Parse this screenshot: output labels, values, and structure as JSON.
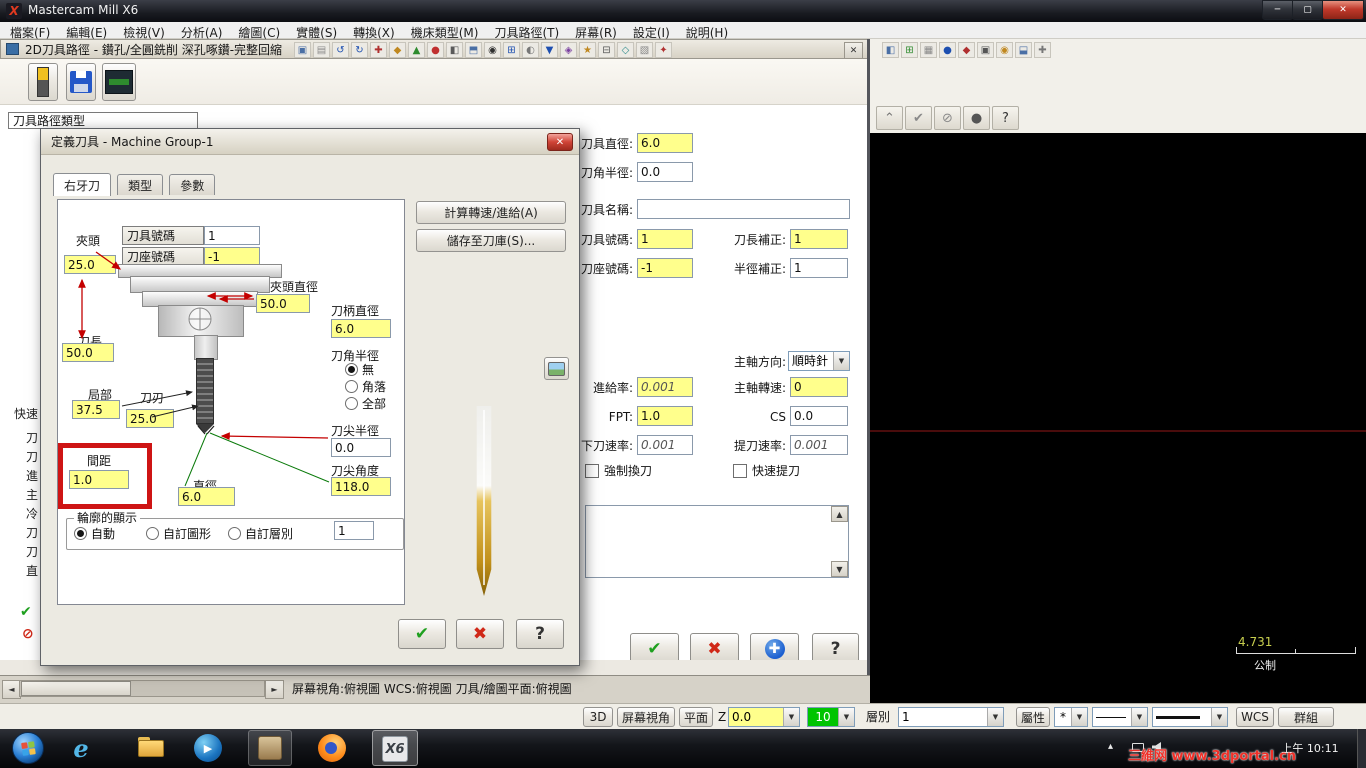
{
  "icons": {
    "close": "✕",
    "minimize": "─",
    "maximize": "▢",
    "dropdown": "▼",
    "up": "▲",
    "down": "▼",
    "left": "◄",
    "right": "►",
    "check": "✔",
    "cross": "✖",
    "help": "?",
    "plus": "✚",
    "slash": "⊘",
    "chevup": "⌃",
    "dot": "●",
    "tray_up": "▴"
  },
  "colors": {
    "field_yellow": "#FFFF8C",
    "annotation": "#CE1414"
  },
  "titlebar": {
    "logo": "X",
    "title": "Mastercam Mill X6"
  },
  "menu": {
    "items": [
      "檔案(F)",
      "編輯(E)",
      "檢視(V)",
      "分析(A)",
      "繪圖(C)",
      "實體(S)",
      "轉換(X)",
      "機床類型(M)",
      "刀具路徑(T)",
      "屏幕(R)",
      "設定(I)",
      "說明(H)"
    ]
  },
  "dlg2d": {
    "title": "2D刀具路徑 - 鑽孔/全圓銑削 深孔啄鑽-完整回縮",
    "tree_header": "刀具路徑類型",
    "quickview": {
      "header": "快速",
      "items": [
        "刀",
        "刀",
        "進",
        "主",
        "冷",
        "刀",
        "刀",
        "直"
      ]
    },
    "strip": [
      {
        "g": "▣",
        "c": "#4a6fa5"
      },
      {
        "g": "▤",
        "c": "#8a8a8a"
      },
      {
        "g": "↺",
        "c": "#1d4fb0"
      },
      {
        "g": "↻",
        "c": "#1d4fb0"
      },
      {
        "g": "✚",
        "c": "#b03030"
      },
      {
        "g": "◆",
        "c": "#c08820"
      },
      {
        "g": "▲",
        "c": "#2e8b2e"
      },
      {
        "g": "●",
        "c": "#c03030"
      },
      {
        "g": "◧",
        "c": "#5a5a5a"
      },
      {
        "g": "⬒",
        "c": "#4a6fa5"
      },
      {
        "g": "◉",
        "c": "#303030"
      },
      {
        "g": "⊞",
        "c": "#1d4fb0"
      },
      {
        "g": "◐",
        "c": "#777777"
      },
      {
        "g": "▼",
        "c": "#1d4fb0"
      },
      {
        "g": "◈",
        "c": "#7a3fa0"
      },
      {
        "g": "★",
        "c": "#c08820"
      },
      {
        "g": "⊟",
        "c": "#555555"
      },
      {
        "g": "◇",
        "c": "#2e8b8b"
      },
      {
        "g": "▧",
        "c": "#888888"
      },
      {
        "g": "✦",
        "c": "#b03030"
      }
    ],
    "strip2": [
      {
        "g": "◧",
        "c": "#4a6fa5"
      },
      {
        "g": "⊞",
        "c": "#2e8b2e"
      },
      {
        "g": "▦",
        "c": "#888888"
      },
      {
        "g": "●",
        "c": "#1d4fb0"
      },
      {
        "g": "◆",
        "c": "#b03030"
      },
      {
        "g": "▣",
        "c": "#555555"
      },
      {
        "g": "◉",
        "c": "#c08820"
      },
      {
        "g": "⬓",
        "c": "#4a6fa5"
      },
      {
        "g": "✚",
        "c": "#777777"
      }
    ],
    "side_icons": [
      {
        "g": "⌃",
        "c": "#777777"
      },
      {
        "g": "✔",
        "c": "#8a8a8a"
      },
      {
        "g": "⊘",
        "c": "#8a8a8a"
      },
      {
        "g": "●",
        "c": "#555555"
      },
      {
        "g": "?",
        "c": "#333333"
      }
    ],
    "panel": {
      "tool_dia_label": "刀具直徑:",
      "tool_dia": "6.0",
      "corner_rad_label": "刀角半徑:",
      "corner_rad": "0.0",
      "tool_name_label": "刀具名稱:",
      "tool_name": "",
      "tool_no_label": "刀具號碼:",
      "tool_no": "1",
      "len_off_label": "刀長補正:",
      "len_off": "1",
      "head_no_label": "刀座號碼:",
      "head_no": "-1",
      "dia_off_label": "半徑補正:",
      "dia_off": "1",
      "spindle_dir_label": "主軸方向:",
      "spindle_dir": "順時針",
      "feed_label": "進給率:",
      "feed": "0.001",
      "spindle_label": "主軸轉速:",
      "spindle_speed": "0",
      "fpt_label": "FPT:",
      "fpt": "1.0",
      "cs_label": "CS",
      "cs": "0.0",
      "plunge_label": "下刀速率:",
      "plunge": "0.001",
      "retract_label": "提刀速率:",
      "retract": "0.001",
      "force_change": "強制換刀",
      "rapid_retract": "快速提刀"
    }
  },
  "tool_dialog": {
    "title": "定義刀具 - Machine Group-1",
    "tabs": [
      "右牙刀",
      "類型",
      "參數"
    ],
    "btn_calc": "計算轉速/進給(A)",
    "btn_save": "儲存至刀庫(S)...",
    "tool_no_label": "刀具號碼",
    "tool_no": "1",
    "head_no_label": "刀座號碼",
    "head_no": "-1",
    "chuck_label": "夾頭",
    "chuck": "25.0",
    "chuck_dia_label": "夾頭直徑",
    "chuck_dia": "50.0",
    "shank_dia_label": "刀柄直徑",
    "shank_dia": "6.0",
    "corner_label": "刀角半徑",
    "corner_opts": [
      "無",
      "角落",
      "全部"
    ],
    "length_label": "刀長",
    "length": "50.0",
    "partial_label": "局部",
    "partial": "37.5",
    "flute_label": "刀刃",
    "flute": "25.0",
    "tip_rad_label": "刀尖半徑",
    "tip_rad": "0.0",
    "pitch_label": "間距",
    "pitch": "1.0",
    "dia_label": "直徑",
    "dia": "6.0",
    "tip_ang_label": "刀尖角度",
    "tip_ang": "118.0",
    "profile_label": "輪廓的顯示",
    "profile_opts": [
      "自動",
      "自訂圖形",
      "自訂層別"
    ],
    "profile_level": "1"
  },
  "statusbar": {
    "text": "屏幕視角:俯視圖   WCS:俯視圖   刀具/繪圖平面:俯視圖"
  },
  "ribbon": {
    "d3": "3D",
    "screen_view": "屏幕視角",
    "plane": "平面",
    "z_label": "Z",
    "z": "0.0",
    "color": "10",
    "layer_label": "層別",
    "layer": "1",
    "attr": "屬性",
    "star": "*",
    "wcs": "WCS",
    "group": "群組"
  },
  "viewport": {
    "scale": "4.731",
    "units": "公制"
  },
  "taskbar": {
    "clock": "上午 10:11",
    "watermark": "三維网 www.3dportal.cn",
    "mastercam": "X6",
    "ie": "e"
  }
}
